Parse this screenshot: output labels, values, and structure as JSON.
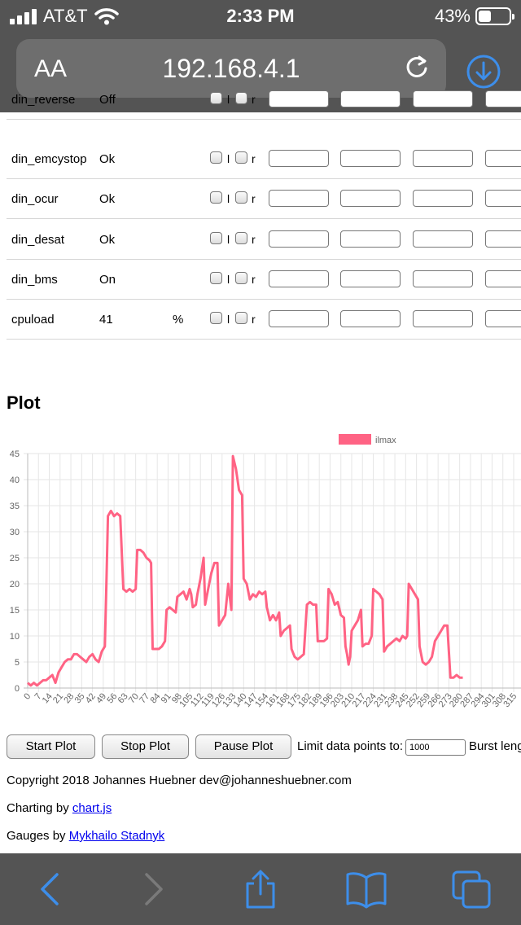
{
  "status_bar": {
    "carrier": "AT&T",
    "time": "2:33 PM",
    "battery": "43%",
    "battery_level": 0.43
  },
  "browser": {
    "text_size_label": "AA",
    "url": "192.168.4.1",
    "accent": "#3d8eea"
  },
  "params": {
    "rows": [
      {
        "name": "din_reverse",
        "value": "Off",
        "unit": ""
      },
      {
        "name": "din_emcystop",
        "value": "Ok",
        "unit": ""
      },
      {
        "name": "din_ocur",
        "value": "Ok",
        "unit": ""
      },
      {
        "name": "din_desat",
        "value": "Ok",
        "unit": ""
      },
      {
        "name": "din_bms",
        "value": "On",
        "unit": ""
      },
      {
        "name": "cpuload",
        "value": "41",
        "unit": "%"
      }
    ],
    "checkbox_left_label": "l",
    "checkbox_right_label": "r"
  },
  "plot": {
    "heading": "Plot",
    "chart_data": {
      "type": "line",
      "series": [
        {
          "name": "ilmax",
          "color": "#ff6384"
        }
      ],
      "ylim": [
        0,
        45
      ],
      "yticks": [
        0,
        5,
        10,
        15,
        20,
        25,
        30,
        35,
        40,
        45
      ],
      "xticks": [
        "0",
        "7",
        "14",
        "21",
        "28",
        "35",
        "42",
        "49",
        "56",
        "63",
        "70",
        "77",
        "84",
        "91",
        "98",
        "105",
        "112",
        "119",
        "126",
        "133",
        "140",
        "147",
        "154",
        "161",
        "168",
        "175",
        "182",
        "189",
        "196",
        "203",
        "210",
        "217",
        "224",
        "231",
        "238",
        "245",
        "252",
        "259",
        "266",
        "273",
        "280",
        "287",
        "294",
        "301",
        "308",
        "315"
      ],
      "grid": true,
      "legend": "top",
      "points": [
        [
          0,
          1
        ],
        [
          2,
          0.5
        ],
        [
          4,
          1
        ],
        [
          6,
          0.5
        ],
        [
          8,
          1
        ],
        [
          10,
          1.5
        ],
        [
          12,
          1.5
        ],
        [
          14,
          2
        ],
        [
          16,
          2.5
        ],
        [
          18,
          1
        ],
        [
          20,
          3
        ],
        [
          22,
          4
        ],
        [
          24,
          5
        ],
        [
          26,
          5.5
        ],
        [
          28,
          5.5
        ],
        [
          30,
          6.5
        ],
        [
          32,
          6.5
        ],
        [
          34,
          6
        ],
        [
          36,
          5.5
        ],
        [
          38,
          5
        ],
        [
          40,
          6
        ],
        [
          42,
          6.5
        ],
        [
          44,
          5.5
        ],
        [
          46,
          5
        ],
        [
          48,
          7
        ],
        [
          50,
          8
        ],
        [
          51,
          20
        ],
        [
          52,
          33
        ],
        [
          54,
          34
        ],
        [
          56,
          33
        ],
        [
          58,
          33.5
        ],
        [
          60,
          33
        ],
        [
          62,
          19
        ],
        [
          64,
          18.5
        ],
        [
          66,
          19
        ],
        [
          68,
          18.5
        ],
        [
          70,
          19
        ],
        [
          71,
          26.5
        ],
        [
          73,
          26.5
        ],
        [
          75,
          26
        ],
        [
          77,
          25
        ],
        [
          79,
          24.5
        ],
        [
          80,
          24
        ],
        [
          81,
          7.5
        ],
        [
          83,
          7.5
        ],
        [
          85,
          7.5
        ],
        [
          87,
          8
        ],
        [
          89,
          9
        ],
        [
          90,
          15
        ],
        [
          92,
          15.5
        ],
        [
          94,
          15
        ],
        [
          96,
          14.5
        ],
        [
          97,
          17.5
        ],
        [
          99,
          18
        ],
        [
          101,
          18.5
        ],
        [
          103,
          17
        ],
        [
          105,
          19
        ],
        [
          106,
          18
        ],
        [
          107,
          15.5
        ],
        [
          109,
          16
        ],
        [
          110,
          18
        ],
        [
          112,
          21
        ],
        [
          114,
          25
        ],
        [
          115,
          16
        ],
        [
          117,
          19
        ],
        [
          119,
          22
        ],
        [
          121,
          24
        ],
        [
          123,
          24
        ],
        [
          124,
          12
        ],
        [
          126,
          13
        ],
        [
          128,
          14
        ],
        [
          130,
          20
        ],
        [
          132,
          15
        ],
        [
          133,
          44.5
        ],
        [
          135,
          42
        ],
        [
          137,
          38
        ],
        [
          138,
          37.5
        ],
        [
          139,
          37
        ],
        [
          140,
          21
        ],
        [
          142,
          20
        ],
        [
          144,
          17
        ],
        [
          146,
          18
        ],
        [
          148,
          17.5
        ],
        [
          150,
          18.5
        ],
        [
          152,
          18
        ],
        [
          154,
          18.5
        ],
        [
          155,
          15.5
        ],
        [
          157,
          13
        ],
        [
          159,
          14
        ],
        [
          161,
          13
        ],
        [
          163,
          14.5
        ],
        [
          164,
          10
        ],
        [
          166,
          11
        ],
        [
          168,
          11.5
        ],
        [
          170,
          12
        ],
        [
          171,
          7.5
        ],
        [
          173,
          6
        ],
        [
          175,
          5.5
        ],
        [
          177,
          6
        ],
        [
          179,
          6.5
        ],
        [
          181,
          16
        ],
        [
          183,
          16.5
        ],
        [
          185,
          16
        ],
        [
          187,
          16
        ],
        [
          188,
          9
        ],
        [
          190,
          9
        ],
        [
          192,
          9
        ],
        [
          194,
          9.5
        ],
        [
          195,
          19
        ],
        [
          197,
          18
        ],
        [
          199,
          16
        ],
        [
          201,
          16.5
        ],
        [
          203,
          14
        ],
        [
          205,
          13.5
        ],
        [
          206,
          8
        ],
        [
          207,
          6.5
        ],
        [
          208,
          4.5
        ],
        [
          209,
          6
        ],
        [
          210,
          11
        ],
        [
          212,
          12
        ],
        [
          214,
          13
        ],
        [
          216,
          15
        ],
        [
          217,
          8
        ],
        [
          219,
          8.5
        ],
        [
          221,
          8.5
        ],
        [
          223,
          10
        ],
        [
          224,
          19
        ],
        [
          226,
          18.5
        ],
        [
          228,
          18
        ],
        [
          230,
          17
        ],
        [
          231,
          7
        ],
        [
          233,
          8
        ],
        [
          235,
          8.5
        ],
        [
          237,
          9
        ],
        [
          239,
          9.5
        ],
        [
          241,
          9
        ],
        [
          243,
          10
        ],
        [
          245,
          9.5
        ],
        [
          246,
          10
        ],
        [
          247,
          20
        ],
        [
          249,
          19
        ],
        [
          251,
          18
        ],
        [
          253,
          17
        ],
        [
          254,
          8
        ],
        [
          256,
          5
        ],
        [
          258,
          4.5
        ],
        [
          260,
          5
        ],
        [
          262,
          6
        ],
        [
          264,
          9
        ],
        [
          266,
          10
        ],
        [
          268,
          11
        ],
        [
          270,
          12
        ],
        [
          272,
          12
        ],
        [
          274,
          2
        ],
        [
          276,
          2
        ],
        [
          278,
          2.5
        ],
        [
          280,
          2
        ],
        [
          282,
          2
        ]
      ]
    }
  },
  "controls": {
    "start_label": "Start Plot",
    "stop_label": "Stop Plot",
    "pause_label": "Pause Plot",
    "limit_label": "Limit data points to:",
    "limit_value": "1000",
    "burst_label": "Burst leng"
  },
  "footer": {
    "copyright": "Copyright 2018 Johannes Huebner dev@johanneshuebner.com",
    "charting_prefix": "Charting by ",
    "charting_link": "chart.js",
    "gauges_prefix": "Gauges by ",
    "gauges_link": "Mykhailo Stadnyk"
  }
}
